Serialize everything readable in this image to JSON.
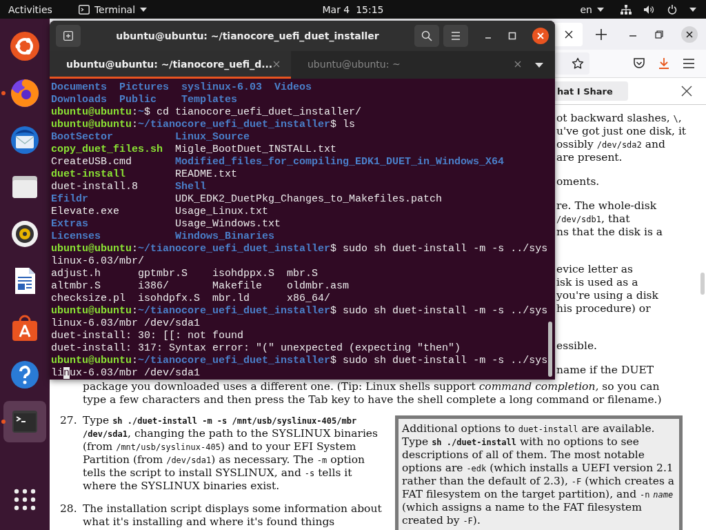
{
  "top_bar": {
    "activities": "Activities",
    "app_menu": "Terminal",
    "clock": "Mar 4  15:15",
    "keyboard_layout": "en"
  },
  "dock": [
    {
      "kind": "ubuntu",
      "running": false,
      "selected": false
    },
    {
      "kind": "firefox",
      "running": true,
      "selected": false
    },
    {
      "kind": "thunderbird",
      "running": false,
      "selected": false
    },
    {
      "kind": "files",
      "running": false,
      "selected": false
    },
    {
      "kind": "rhythmbox",
      "running": false,
      "selected": false
    },
    {
      "kind": "writer",
      "running": false,
      "selected": false
    },
    {
      "kind": "software",
      "running": false,
      "selected": false
    },
    {
      "kind": "help",
      "running": false,
      "selected": false
    },
    {
      "kind": "terminal",
      "running": true,
      "selected": true
    },
    {
      "kind": "apps",
      "running": false,
      "selected": false
    }
  ],
  "browser": {
    "notification_button": "hat I Share",
    "fragments": [
      [
        [
          "ot backward slashes, ",
          {
            "t": "\\",
            "kind": "code"
          },
          ","
        ],
        [
          "u've got just one disk, it"
        ],
        [
          "ossibly ",
          {
            "t": "/dev/sda2",
            "kind": "code"
          },
          " and"
        ],
        [
          "are present."
        ]
      ],
      [
        [
          "oments."
        ]
      ],
      [
        [
          "re. The whole-disk"
        ],
        [
          {
            "t": "/dev/sdb1",
            "kind": "code"
          },
          ", that"
        ],
        [
          "ns that the disk is a"
        ]
      ],
      [
        [
          "evice letter as"
        ],
        [
          "isk is used as a"
        ],
        [
          "you're using a disk"
        ],
        [
          "his procedure) or"
        ]
      ],
      [
        [
          "essible."
        ]
      ],
      [
        [
          "name if the DUET"
        ]
      ]
    ],
    "continuation": [
      [
        "package you downloaded uses a different one. (Tip: Linux shells support ",
        {
          "t": "command completion,",
          "kind": "italic"
        },
        " so you can"
      ],
      [
        "type a few characters and then press the Tab key to have the shell complete a long command or filename.)"
      ]
    ],
    "steps": [
      {
        "number": "27.",
        "segments": [
          "Type ",
          {
            "t": "sh ./duet-install -m -s /mnt/usb/syslinux-405/mbr /dev/sda1",
            "kind": "code_bold"
          },
          ", changing the path to the SYSLINUX binaries (from ",
          {
            "t": "/mnt/usb/syslinux-405",
            "kind": "code"
          },
          ") and to your EFI System Partition (from ",
          {
            "t": "/dev/sda1",
            "kind": "code"
          },
          ") as necessary. The ",
          {
            "t": "-m",
            "kind": "code"
          },
          " option tells the script to install SYSLINUX, and ",
          {
            "t": "-s",
            "kind": "code"
          },
          " tells it where the SYSLINUX binaries exist."
        ]
      },
      {
        "number": "28.",
        "segments": [
          "The installation script displays some information about what it's installing and where it's found things"
        ]
      }
    ],
    "note_box": [
      "Additional options to ",
      {
        "t": "duet-install",
        "kind": "code"
      },
      " are available. Type ",
      {
        "t": "sh ./duet-install",
        "kind": "code_bold"
      },
      " with no options to see descriptions of all of them. The most notable options are ",
      {
        "t": "-edk",
        "kind": "code"
      },
      " (which installs a UEFI version 2.1 rather than the default of 2.3), ",
      {
        "t": "-F",
        "kind": "code"
      },
      " (which creates a FAT filesystem on the target partition), and ",
      {
        "t": "-n",
        "kind": "code"
      },
      {
        "t": "name",
        "kind": "code_italic"
      },
      " (which assigns a name to the FAT filesystem created by ",
      {
        "t": "-F",
        "kind": "code"
      },
      ")."
    ]
  },
  "terminal": {
    "title": "ubuntu@ubuntu: ~/tianocore_uefi_duet_installer",
    "tabs": [
      {
        "label": "ubuntu@ubuntu: ~/tianocore_uefi_d...",
        "selected": true
      },
      {
        "label": "ubuntu@ubuntu: ~",
        "selected": false
      }
    ],
    "lines": [
      {
        "kind": "listing",
        "rows": [
          [
            {
              "t": "Documents",
              "kind": "dir"
            },
            {
              "t": "Pictures",
              "kind": "dir"
            },
            {
              "t": "syslinux-6.03",
              "kind": "dir"
            },
            {
              "t": "Videos",
              "kind": "dir"
            }
          ],
          [
            {
              "t": "Downloads",
              "kind": "dir"
            },
            {
              "t": "Public",
              "kind": "dir"
            },
            {
              "t": "Templates",
              "kind": "dir"
            }
          ]
        ]
      },
      {
        "kind": "line",
        "segments": [
          {
            "t": "ubuntu@ubuntu",
            "kind": "user"
          },
          ":",
          {
            "t": "~",
            "kind": "dir"
          },
          "$ cd tianocore_uefi_duet_installer/"
        ]
      },
      {
        "kind": "line",
        "segments": [
          {
            "t": "ubuntu@ubuntu",
            "kind": "user"
          },
          ":",
          {
            "t": "~/tianocore_uefi_duet_installer",
            "kind": "dir"
          },
          "$ ls"
        ]
      },
      {
        "kind": "listing",
        "rows": [
          [
            {
              "t": "BootSector",
              "kind": "dir"
            },
            {
              "t": "Linux_Source",
              "kind": "dir"
            }
          ],
          [
            {
              "t": "copy_duet_files.sh",
              "kind": "exec"
            },
            "Migle_BootDuet_INSTALL.txt"
          ],
          [
            "CreateUSB.cmd",
            {
              "t": "Modified_files_for_compiling_EDK1_DUET_in_Windows_X64",
              "kind": "dir"
            }
          ],
          [
            {
              "t": "duet-install",
              "kind": "exec"
            },
            "README.txt"
          ],
          [
            "duet-install.8",
            {
              "t": "Shell",
              "kind": "dir"
            }
          ],
          [
            {
              "t": "Efildr",
              "kind": "dir"
            },
            "UDK_EDK2_DuetPkg_Changes_to_Makefiles.patch"
          ],
          [
            "Elevate.exe",
            "Usage_Linux.txt"
          ],
          [
            {
              "t": "Extras",
              "kind": "dir"
            },
            "Usage_Windows.txt"
          ],
          [
            {
              "t": "Licenses",
              "kind": "dir"
            },
            {
              "t": "Windows_Binaries",
              "kind": "dir"
            }
          ]
        ]
      },
      {
        "kind": "line",
        "segments": [
          {
            "t": "ubuntu@ubuntu",
            "kind": "user"
          },
          ":",
          {
            "t": "~/tianocore_uefi_duet_installer",
            "kind": "dir"
          },
          "$ sudo sh duet-install -m -s ../sys"
        ]
      },
      {
        "kind": "line",
        "segments": [
          "linux-6.03/mbr/"
        ]
      },
      {
        "kind": "listing",
        "rows": [
          [
            "adjust.h",
            "gptmbr.S",
            "isohdppx.S",
            "mbr.S"
          ],
          [
            "altmbr.S",
            "i386/",
            "Makefile",
            "oldmbr.asm"
          ],
          [
            "checksize.pl",
            "isohdpfx.S",
            "mbr.ld",
            "x86_64/"
          ]
        ]
      },
      {
        "kind": "line",
        "segments": [
          {
            "t": "ubuntu@ubuntu",
            "kind": "user"
          },
          ":",
          {
            "t": "~/tianocore_uefi_duet_installer",
            "kind": "dir"
          },
          "$ sudo sh duet-install -m -s ../sys"
        ]
      },
      {
        "kind": "line",
        "segments": [
          "linux-6.03/mbr /dev/sda1"
        ]
      },
      {
        "kind": "line",
        "segments": [
          "duet-install: 30: [[: not found"
        ]
      },
      {
        "kind": "line",
        "segments": [
          "duet-install: 317: Syntax error: \"(\" unexpected (expecting \"then\")"
        ]
      },
      {
        "kind": "line",
        "segments": [
          {
            "t": "ubuntu@ubuntu",
            "kind": "user"
          },
          ":",
          {
            "t": "~/tianocore_uefi_duet_installer",
            "kind": "dir"
          },
          "$ sudo sh duet-install -m -s ../sys"
        ]
      },
      {
        "kind": "line",
        "segments": [
          "li",
          {
            "t": "n",
            "kind": "cursor"
          },
          "ux-6.03/mbr /dev/sda1"
        ]
      }
    ]
  }
}
